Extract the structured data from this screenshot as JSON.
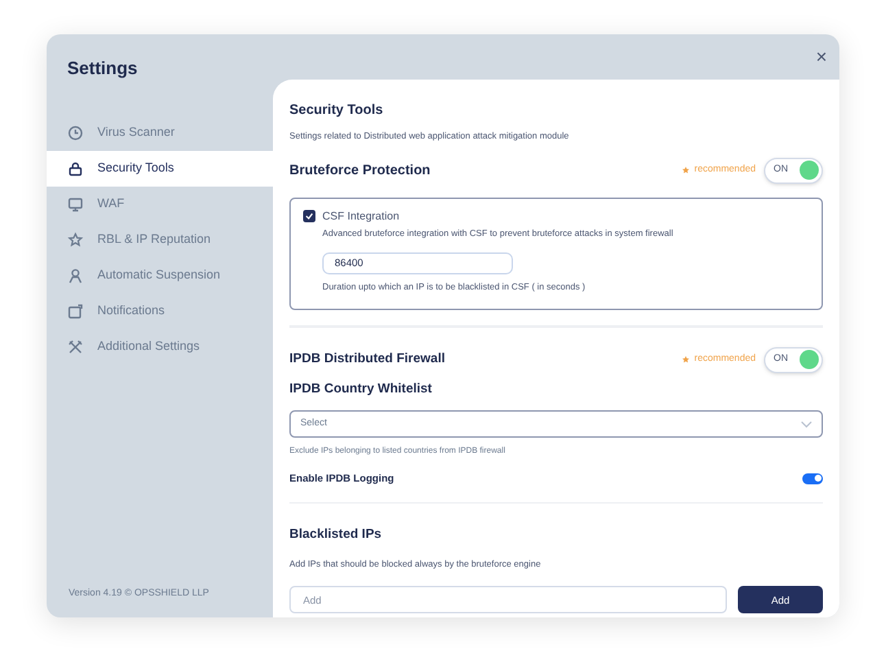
{
  "window": {
    "title": "Settings",
    "close": "×"
  },
  "sidebar": {
    "items": [
      {
        "label": "Virus Scanner",
        "selected": false
      },
      {
        "label": "Security Tools",
        "selected": true
      },
      {
        "label": "WAF",
        "selected": false
      },
      {
        "label": "RBL & IP Reputation",
        "selected": false
      },
      {
        "label": "Automatic Suspension",
        "selected": false
      },
      {
        "label": "Notifications",
        "selected": false
      },
      {
        "label": "Additional Settings",
        "selected": false
      }
    ],
    "footer": "Version 4.19 © OPSSHIELD LLP"
  },
  "content": {
    "title": "Security Tools",
    "description": "Settings related to Distributed web application attack mitigation module",
    "bruteforce": {
      "title": "Bruteforce Protection",
      "badge": "recommended",
      "toggle": {
        "label": "ON",
        "on": true
      },
      "csf": {
        "label": "CSF Integration",
        "checked": true,
        "description": "Advanced bruteforce integration with CSF to prevent bruteforce attacks in system firewall",
        "value": "86400",
        "hint": "Duration upto which an IP is to be blacklisted in CSF ( in seconds )"
      }
    },
    "ipdb": {
      "title": "IPDB Distributed Firewall",
      "badge": "recommended",
      "toggle": {
        "label": "ON",
        "on": true
      },
      "whitelist_title": "IPDB Country Whitelist",
      "select_placeholder": "Select",
      "whitelist_hint": "Exclude IPs belonging to listed countries from IPDB firewall",
      "logging": {
        "label": "Enable IPDB Logging",
        "on": true
      }
    },
    "blacklist": {
      "title": "Blacklisted IPs",
      "description": "Add IPs that should be blocked always by the bruteforce engine",
      "placeholder": "Add",
      "button": "Add"
    }
  }
}
